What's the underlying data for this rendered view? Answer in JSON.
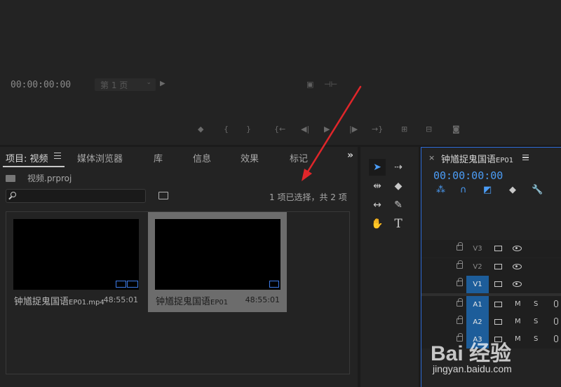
{
  "monitor": {
    "timecode": "00:00:00:00",
    "page_select": "第 1 页"
  },
  "project": {
    "tabs": [
      "项目: 视频",
      "媒体浏览器",
      "库",
      "信息",
      "效果",
      "标记"
    ],
    "more": "»",
    "project_name": "视频.prproj",
    "search_placeholder": "",
    "selection_status": "1 项已选择，共 2 项",
    "items": [
      {
        "name": "钟馗捉鬼国语",
        "suffix": "EP01.mp4",
        "duration": "48:55:01",
        "selected": false
      },
      {
        "name": "钟馗捉鬼国语",
        "suffix": "EP01",
        "duration": "48:55:01",
        "selected": true
      }
    ]
  },
  "timeline": {
    "close": "×",
    "title": "钟馗捉鬼国语",
    "title_suffix": "EP01",
    "timecode": "00:00:00:00",
    "video_tracks": [
      "V3",
      "V2",
      "V1"
    ],
    "audio_tracks": [
      "A1",
      "A2",
      "A3"
    ],
    "mute_label": "M",
    "solo_label": "S"
  },
  "colors": {
    "accent": "#4b9cf5",
    "annotation_arrow": "#e0262a",
    "selected_card": "#6c6c6c",
    "active_track": "#1d5d9a"
  },
  "watermark": {
    "logo": "Bai 经验",
    "url": "jingyan.baidu.com"
  }
}
